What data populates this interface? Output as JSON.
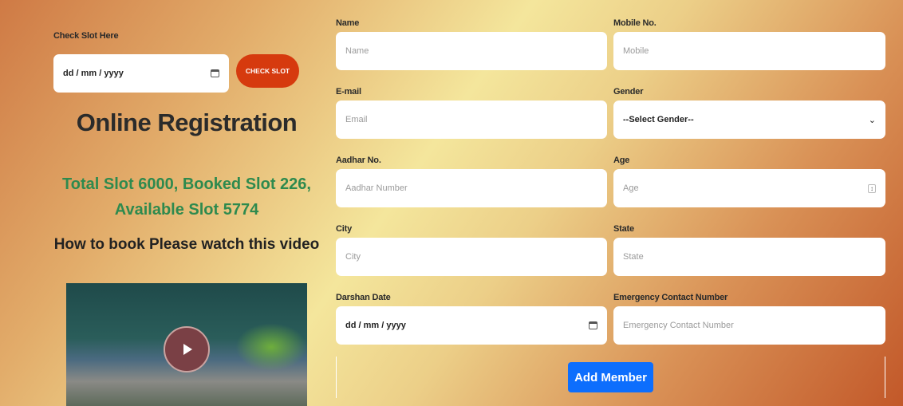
{
  "check_slot": {
    "label": "Check Slot Here",
    "date_placeholder": "dd / mm / yyyy",
    "button": "CHECK SLOT"
  },
  "title": "Online Registration",
  "slots": {
    "line1": "Total Slot 6000, Booked Slot 226,",
    "line2": "Available Slot 5774"
  },
  "video_heading": "How to book Please watch this video",
  "form": {
    "fields": [
      {
        "label": "Name",
        "placeholder": "Name"
      },
      {
        "label": "Mobile No.",
        "placeholder": "Mobile"
      },
      {
        "label": "E-mail",
        "placeholder": "Email"
      },
      {
        "label": "Gender",
        "value": "--Select Gender--"
      },
      {
        "label": "Aadhar No.",
        "placeholder": "Aadhar Number"
      },
      {
        "label": "Age",
        "placeholder": "Age"
      },
      {
        "label": "City",
        "placeholder": "City"
      },
      {
        "label": "State",
        "placeholder": "State"
      },
      {
        "label": "Darshan Date",
        "placeholder": "dd / mm / yyyy"
      },
      {
        "label": "Emergency Contact Number",
        "placeholder": "Emergency Contact Number"
      }
    ],
    "add_member": "Add Member"
  },
  "colors": {
    "check_button": "#d63a0e",
    "add_button": "#0d6efd",
    "slot_text": "#2e8a4e"
  }
}
